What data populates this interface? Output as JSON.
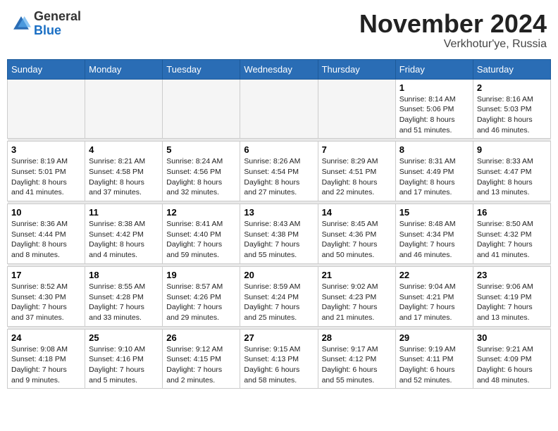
{
  "header": {
    "logo_general": "General",
    "logo_blue": "Blue",
    "month": "November 2024",
    "location": "Verkhotur'ye, Russia"
  },
  "days_of_week": [
    "Sunday",
    "Monday",
    "Tuesday",
    "Wednesday",
    "Thursday",
    "Friday",
    "Saturday"
  ],
  "weeks": [
    [
      {
        "day": "",
        "detail": ""
      },
      {
        "day": "",
        "detail": ""
      },
      {
        "day": "",
        "detail": ""
      },
      {
        "day": "",
        "detail": ""
      },
      {
        "day": "",
        "detail": ""
      },
      {
        "day": "1",
        "detail": "Sunrise: 8:14 AM\nSunset: 5:06 PM\nDaylight: 8 hours\nand 51 minutes."
      },
      {
        "day": "2",
        "detail": "Sunrise: 8:16 AM\nSunset: 5:03 PM\nDaylight: 8 hours\nand 46 minutes."
      }
    ],
    [
      {
        "day": "3",
        "detail": "Sunrise: 8:19 AM\nSunset: 5:01 PM\nDaylight: 8 hours\nand 41 minutes."
      },
      {
        "day": "4",
        "detail": "Sunrise: 8:21 AM\nSunset: 4:58 PM\nDaylight: 8 hours\nand 37 minutes."
      },
      {
        "day": "5",
        "detail": "Sunrise: 8:24 AM\nSunset: 4:56 PM\nDaylight: 8 hours\nand 32 minutes."
      },
      {
        "day": "6",
        "detail": "Sunrise: 8:26 AM\nSunset: 4:54 PM\nDaylight: 8 hours\nand 27 minutes."
      },
      {
        "day": "7",
        "detail": "Sunrise: 8:29 AM\nSunset: 4:51 PM\nDaylight: 8 hours\nand 22 minutes."
      },
      {
        "day": "8",
        "detail": "Sunrise: 8:31 AM\nSunset: 4:49 PM\nDaylight: 8 hours\nand 17 minutes."
      },
      {
        "day": "9",
        "detail": "Sunrise: 8:33 AM\nSunset: 4:47 PM\nDaylight: 8 hours\nand 13 minutes."
      }
    ],
    [
      {
        "day": "10",
        "detail": "Sunrise: 8:36 AM\nSunset: 4:44 PM\nDaylight: 8 hours\nand 8 minutes."
      },
      {
        "day": "11",
        "detail": "Sunrise: 8:38 AM\nSunset: 4:42 PM\nDaylight: 8 hours\nand 4 minutes."
      },
      {
        "day": "12",
        "detail": "Sunrise: 8:41 AM\nSunset: 4:40 PM\nDaylight: 7 hours\nand 59 minutes."
      },
      {
        "day": "13",
        "detail": "Sunrise: 8:43 AM\nSunset: 4:38 PM\nDaylight: 7 hours\nand 55 minutes."
      },
      {
        "day": "14",
        "detail": "Sunrise: 8:45 AM\nSunset: 4:36 PM\nDaylight: 7 hours\nand 50 minutes."
      },
      {
        "day": "15",
        "detail": "Sunrise: 8:48 AM\nSunset: 4:34 PM\nDaylight: 7 hours\nand 46 minutes."
      },
      {
        "day": "16",
        "detail": "Sunrise: 8:50 AM\nSunset: 4:32 PM\nDaylight: 7 hours\nand 41 minutes."
      }
    ],
    [
      {
        "day": "17",
        "detail": "Sunrise: 8:52 AM\nSunset: 4:30 PM\nDaylight: 7 hours\nand 37 minutes."
      },
      {
        "day": "18",
        "detail": "Sunrise: 8:55 AM\nSunset: 4:28 PM\nDaylight: 7 hours\nand 33 minutes."
      },
      {
        "day": "19",
        "detail": "Sunrise: 8:57 AM\nSunset: 4:26 PM\nDaylight: 7 hours\nand 29 minutes."
      },
      {
        "day": "20",
        "detail": "Sunrise: 8:59 AM\nSunset: 4:24 PM\nDaylight: 7 hours\nand 25 minutes."
      },
      {
        "day": "21",
        "detail": "Sunrise: 9:02 AM\nSunset: 4:23 PM\nDaylight: 7 hours\nand 21 minutes."
      },
      {
        "day": "22",
        "detail": "Sunrise: 9:04 AM\nSunset: 4:21 PM\nDaylight: 7 hours\nand 17 minutes."
      },
      {
        "day": "23",
        "detail": "Sunrise: 9:06 AM\nSunset: 4:19 PM\nDaylight: 7 hours\nand 13 minutes."
      }
    ],
    [
      {
        "day": "24",
        "detail": "Sunrise: 9:08 AM\nSunset: 4:18 PM\nDaylight: 7 hours\nand 9 minutes."
      },
      {
        "day": "25",
        "detail": "Sunrise: 9:10 AM\nSunset: 4:16 PM\nDaylight: 7 hours\nand 5 minutes."
      },
      {
        "day": "26",
        "detail": "Sunrise: 9:12 AM\nSunset: 4:15 PM\nDaylight: 7 hours\nand 2 minutes."
      },
      {
        "day": "27",
        "detail": "Sunrise: 9:15 AM\nSunset: 4:13 PM\nDaylight: 6 hours\nand 58 minutes."
      },
      {
        "day": "28",
        "detail": "Sunrise: 9:17 AM\nSunset: 4:12 PM\nDaylight: 6 hours\nand 55 minutes."
      },
      {
        "day": "29",
        "detail": "Sunrise: 9:19 AM\nSunset: 4:11 PM\nDaylight: 6 hours\nand 52 minutes."
      },
      {
        "day": "30",
        "detail": "Sunrise: 9:21 AM\nSunset: 4:09 PM\nDaylight: 6 hours\nand 48 minutes."
      }
    ]
  ]
}
